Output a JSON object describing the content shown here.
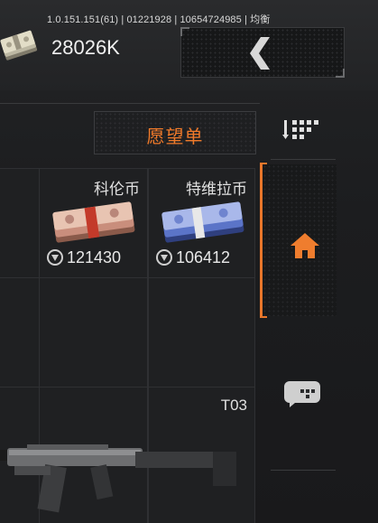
{
  "header": {
    "version_text": "1.0.151.151(61) | 01221928 | 10654724985 | 均衡",
    "currency_value": "28026K",
    "currency_icon": "cash-bundle-icon",
    "back_icon": "chevron-left-icon"
  },
  "wishlist": {
    "label": "愿望单",
    "filter_icon": "filter-list-icon"
  },
  "items": [
    {
      "title": "科伦币",
      "price": "121430",
      "icon": "cash-bundle-icon",
      "tint": "#d9a592"
    },
    {
      "title": "特维拉币",
      "price": "106412",
      "icon": "cash-bundle-icon",
      "tint": "#5b74c8"
    }
  ],
  "weapon": {
    "title": "T03",
    "icon": "rifle-icon"
  },
  "sidebar": {
    "home_icon": "home-icon",
    "second_icon": "chat-icon"
  },
  "colors": {
    "accent": "#e9772b",
    "background": "#1b1c1e"
  }
}
